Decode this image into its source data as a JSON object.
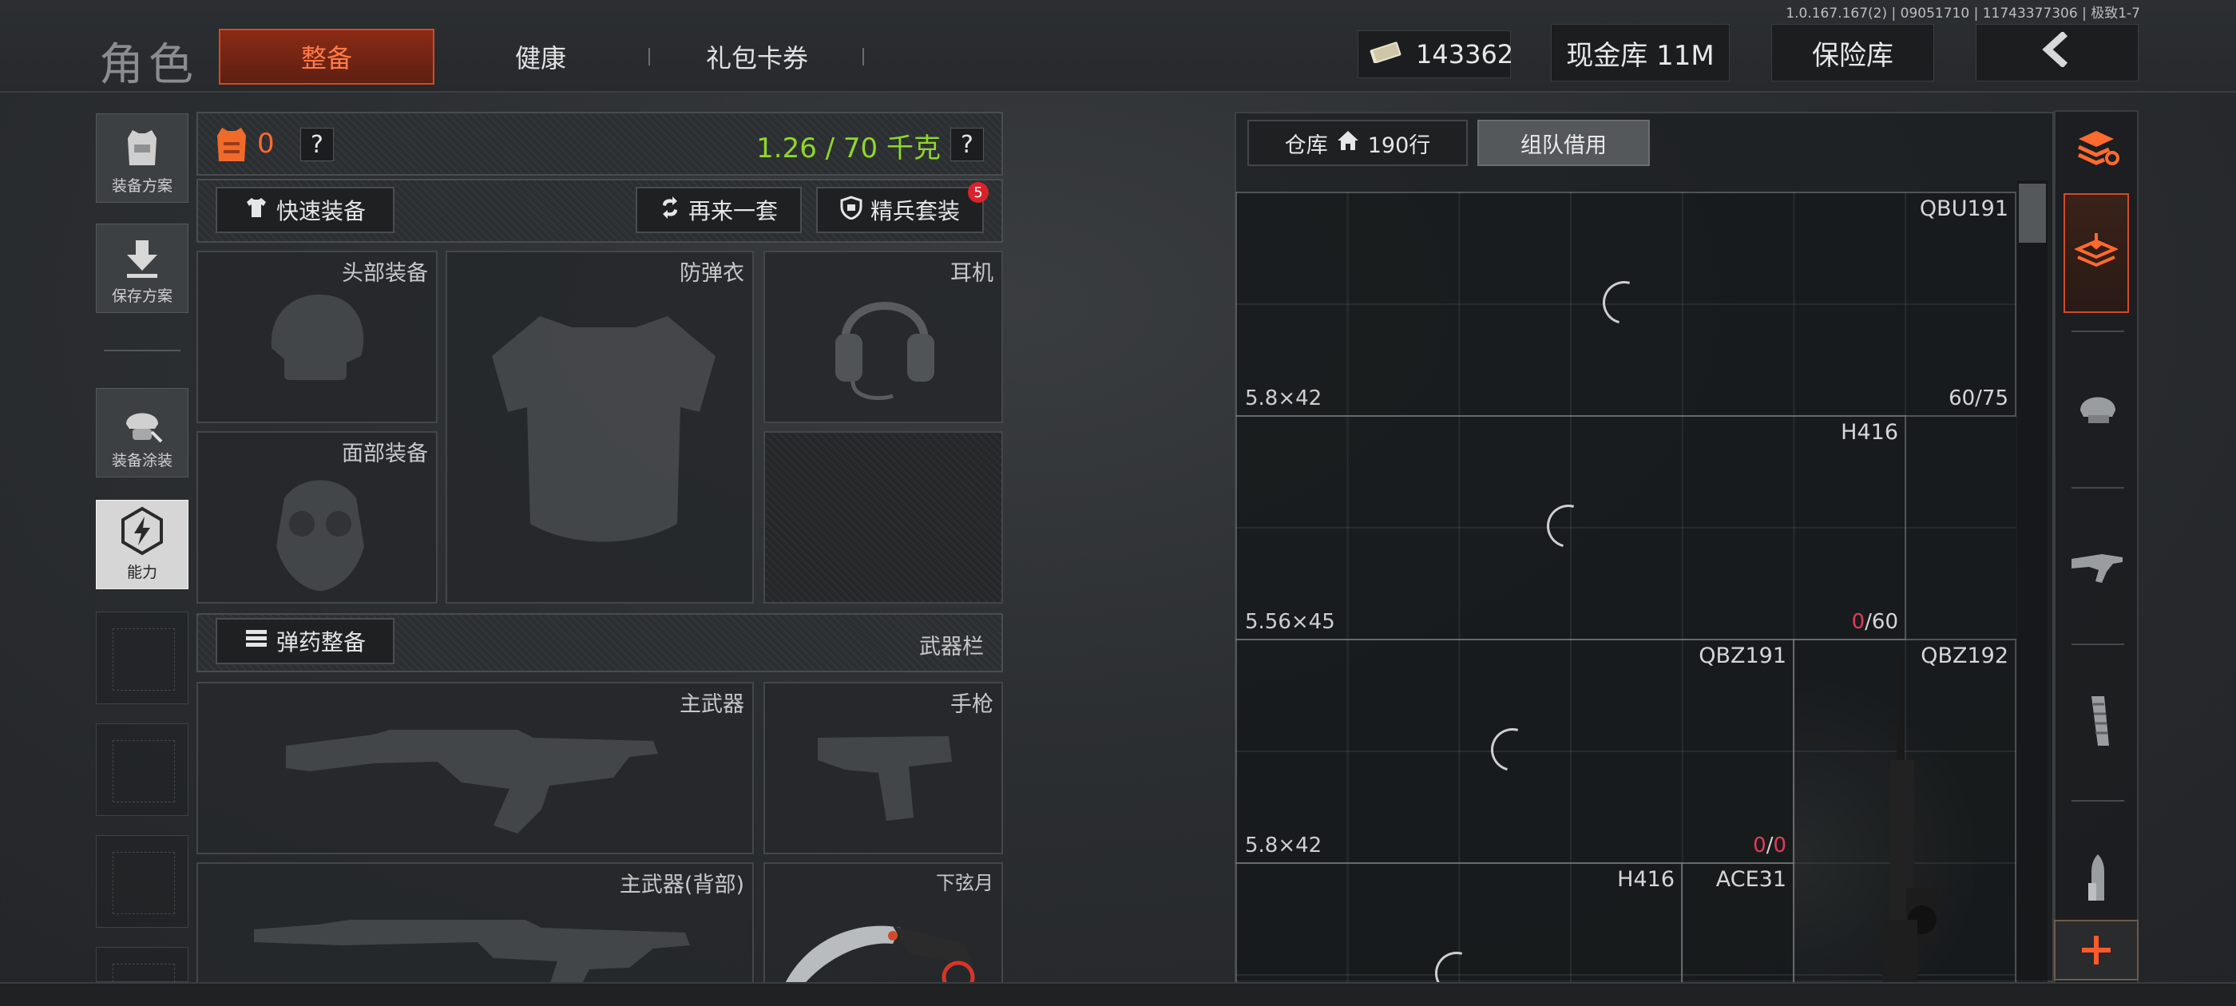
{
  "version": "1.0.167.167(2) | 09051710 | 11743377306 | 极致1-7",
  "header": {
    "title": "角色",
    "tabs": [
      {
        "label": "整备",
        "active": true
      },
      {
        "label": "健康",
        "active": false
      },
      {
        "label": "礼包卡券",
        "active": false
      }
    ],
    "money": "143362",
    "cash_vault": "现金库 11M",
    "insurance": "保险库"
  },
  "sidebar": {
    "items": [
      {
        "label": "装备方案"
      },
      {
        "label": "保存方案"
      },
      {
        "label": "装备涂装"
      },
      {
        "label": "能力"
      }
    ]
  },
  "loadout": {
    "armor_count": "0",
    "help": "?",
    "weight": "1.26 / 70 千克",
    "quick_equip": "快速装备",
    "another_set": "再来一套",
    "elite_set": "精兵套装",
    "elite_badge": "5",
    "ammo_equip": "弹药整备",
    "weapon_bar": "武器栏"
  },
  "slots": {
    "head": "头部装备",
    "vest": "防弹衣",
    "headset": "耳机",
    "face": "面部装备",
    "primary": "主武器",
    "pistol": "手枪",
    "primary_back": "主武器(背部)",
    "melee": "下弦月"
  },
  "warehouse": {
    "tab_storage": "仓库",
    "rows": "190行",
    "tab_team": "组队借用",
    "items": [
      {
        "name": "QBU191",
        "caliber": "5.8×42",
        "count": "60/75"
      },
      {
        "name": "H416",
        "caliber": "5.56×45",
        "count_zero": "0",
        "count_rest": "/60"
      },
      {
        "name": "QBZ191",
        "caliber": "5.8×42",
        "count_zero": "0",
        "count_sep": "/",
        "count_max": "0"
      },
      {
        "name": "QBZ192"
      },
      {
        "name": "H416"
      },
      {
        "name": "ACE31"
      }
    ]
  },
  "colors": {
    "accent": "#ff6a2e",
    "weight": "#8fd82a",
    "alert": "#e23a5a"
  }
}
